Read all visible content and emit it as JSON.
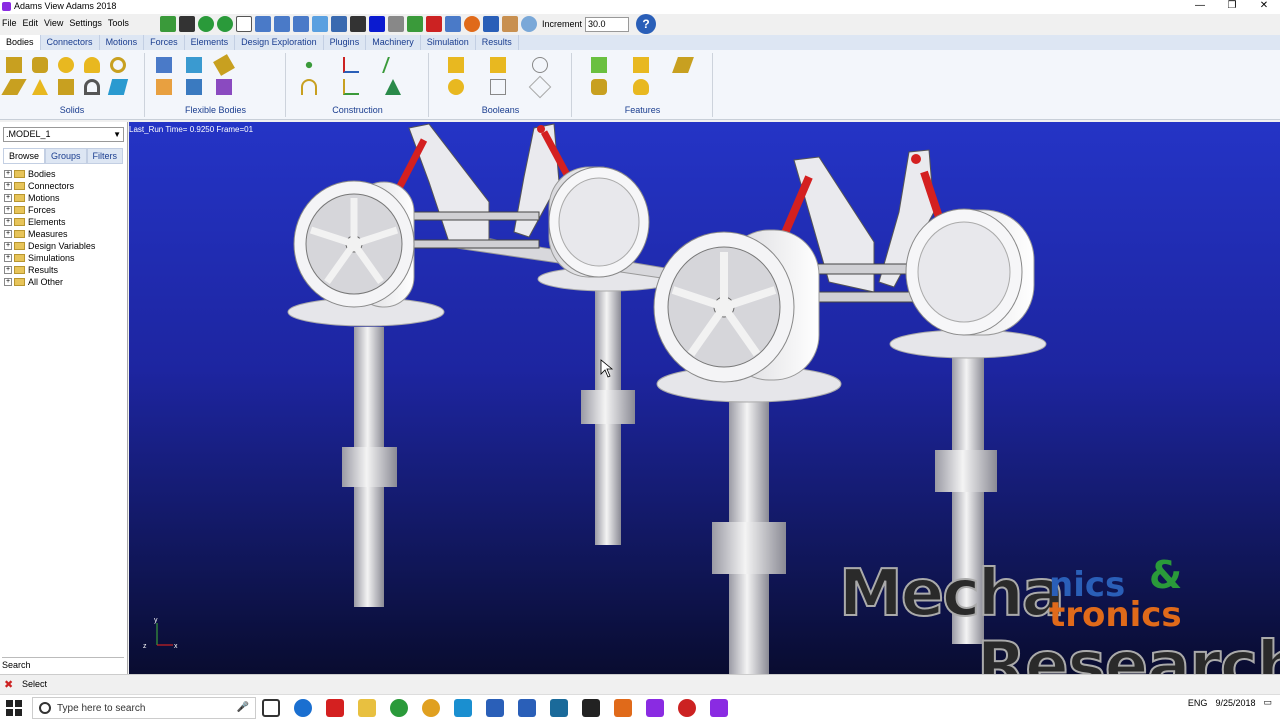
{
  "window": {
    "title": "Adams View Adams 2018",
    "controls": [
      "—",
      "❐",
      "✕"
    ]
  },
  "menu": [
    "File",
    "Edit",
    "View",
    "Settings",
    "Tools"
  ],
  "toolbar": {
    "increment_label": "Increment",
    "increment_value": "30.0",
    "help_label": "?"
  },
  "ribbon": {
    "tabs": [
      "Bodies",
      "Connectors",
      "Motions",
      "Forces",
      "Elements",
      "Design Exploration",
      "Plugins",
      "Machinery",
      "Simulation",
      "Results"
    ],
    "groups": [
      "Solids",
      "Flexible Bodies",
      "Construction",
      "Booleans",
      "Features"
    ]
  },
  "browser": {
    "model": ".MODEL_1",
    "tabs": [
      "Browse",
      "Groups",
      "Filters"
    ],
    "tree": [
      "Bodies",
      "Connectors",
      "Motions",
      "Forces",
      "Elements",
      "Measures",
      "Design Variables",
      "Simulations",
      "Results",
      "All Other"
    ],
    "search_label": "Search"
  },
  "viewport": {
    "run_info": "Last_Run   Time= 0.9250  Frame=01"
  },
  "axis_labels": {
    "y": "y",
    "z": "z",
    "x": "x"
  },
  "status": {
    "text": "Select"
  },
  "watermark": {
    "mecha": "Mecha",
    "nics": "nics",
    "amp": "&",
    "tronics": "tronics",
    "research": "Research"
  },
  "taskbar": {
    "search_placeholder": "Type here to search",
    "lang": "ENG",
    "date": "9/25/2018"
  },
  "colors": {
    "viewport_top": "#2434c6",
    "viewport_bottom": "#090c30",
    "spring": "#d42020",
    "part": "#e8e8e8"
  }
}
